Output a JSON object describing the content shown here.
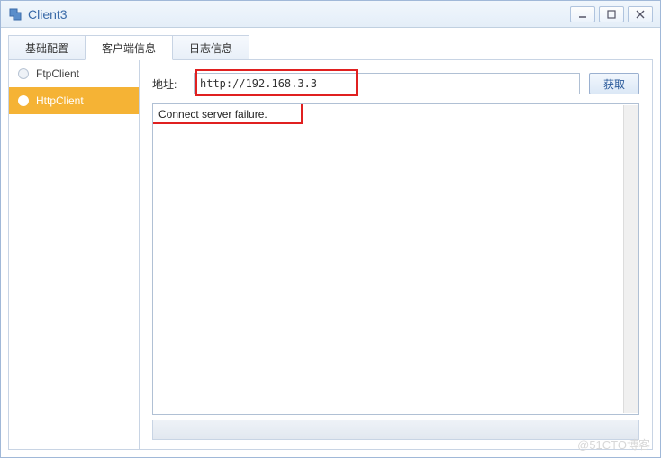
{
  "window": {
    "title": "Client3"
  },
  "tabs": [
    {
      "label": "基础配置"
    },
    {
      "label": "客户端信息"
    },
    {
      "label": "日志信息"
    }
  ],
  "sidebar": {
    "items": [
      {
        "label": "FtpClient"
      },
      {
        "label": "HttpClient"
      }
    ]
  },
  "main": {
    "address_label": "地址:",
    "address_value": "http://192.168.3.3",
    "fetch_label": "获取",
    "result_text": "Connect server failure."
  },
  "watermark": "@51CTO博客"
}
